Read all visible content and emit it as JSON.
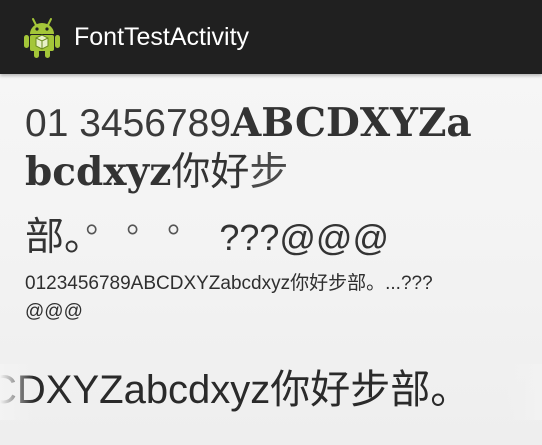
{
  "action_bar": {
    "title": "FontTestActivity",
    "icon": "android-robot-icon",
    "background": "#202020",
    "icon_color": "#A4C639"
  },
  "font_tests": {
    "large_mixed": {
      "line1_digits": "01  3456789",
      "line1_serif": "ABCDXYZa",
      "line2_serif": "bcdxyz",
      "line2_cjk": "你好",
      "line2_step": "步",
      "line3_text": "部。",
      "line3_dots": "。 。 。",
      "line3_symbols": "???@@@"
    },
    "small_plain": {
      "text": "0123456789ABCDXYZabcdxyz你好步部。...???@@@"
    },
    "marquee": {
      "text": "CDXYZabcdxyz你好步部。"
    }
  }
}
